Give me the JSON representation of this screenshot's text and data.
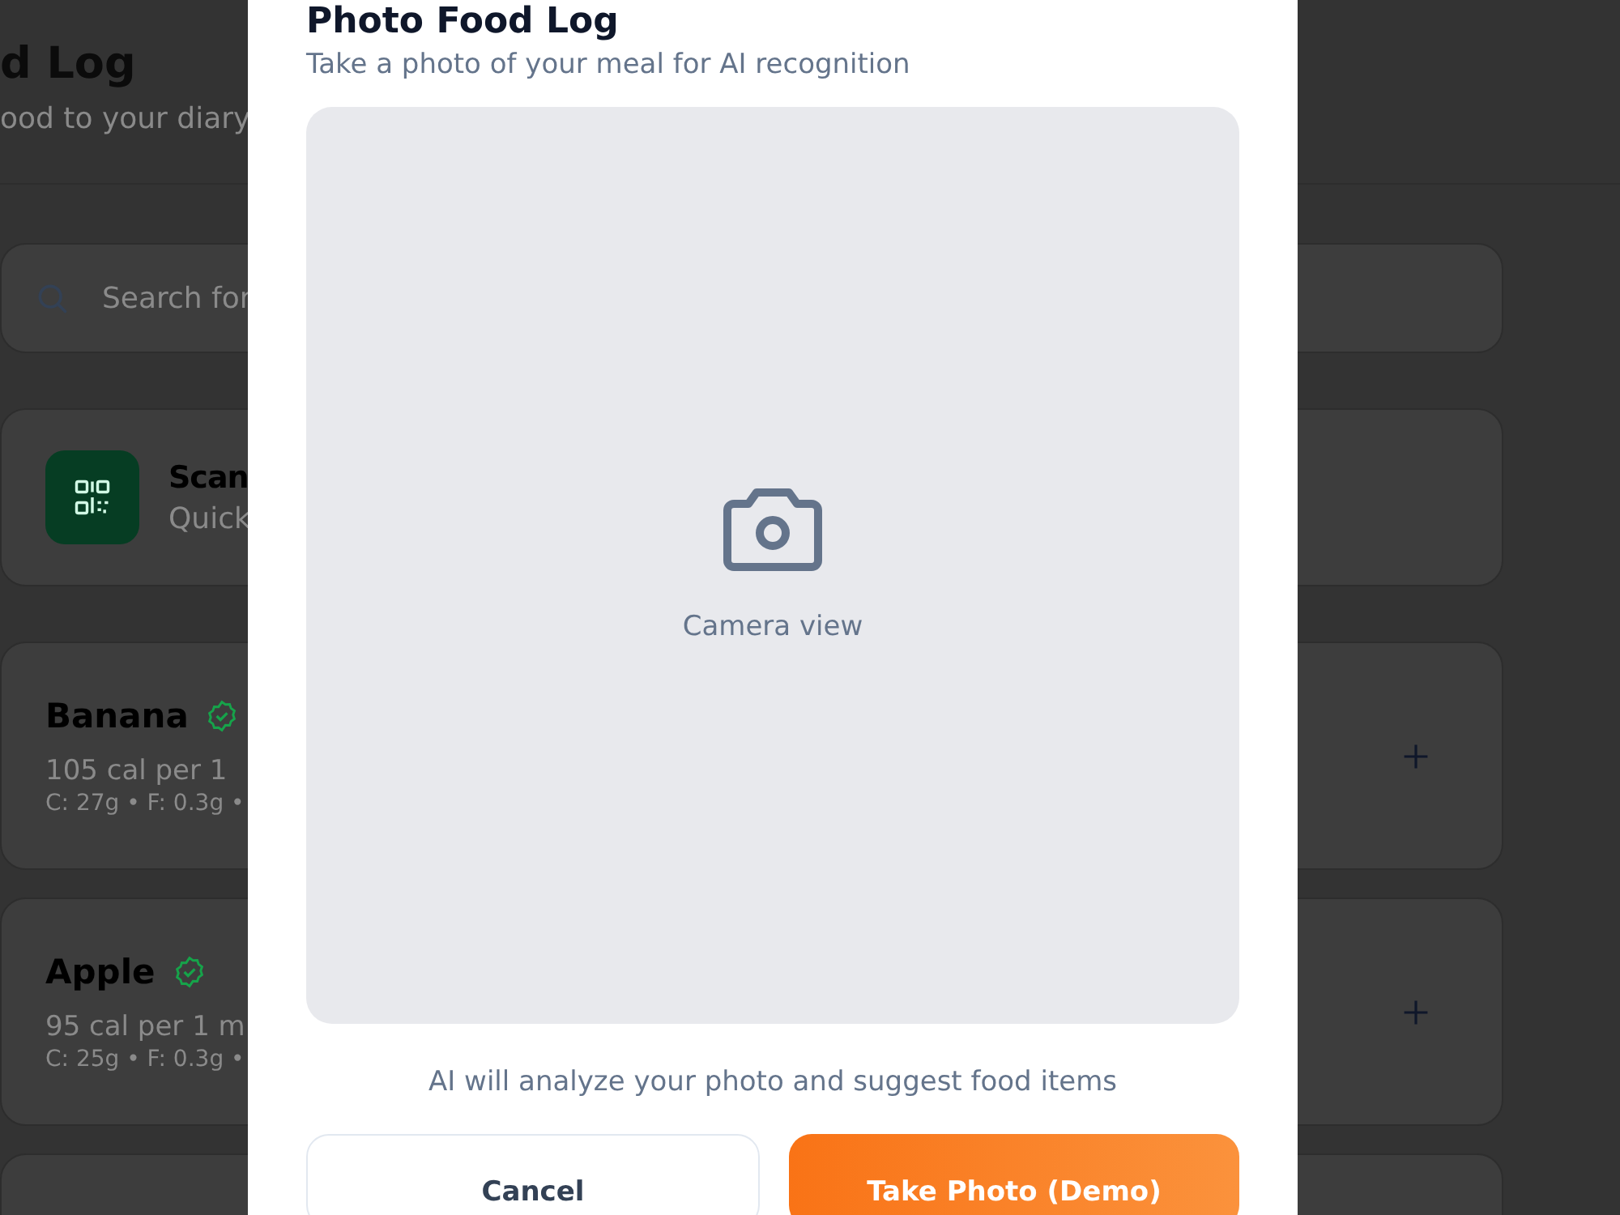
{
  "page": {
    "title": "d Log",
    "subtitle": "ood to your diary"
  },
  "search": {
    "placeholder": "Search for"
  },
  "scan_card": {
    "title": "Scan",
    "subtitle": "Quick"
  },
  "foods": [
    {
      "name": "Banana",
      "verified": true,
      "calories": "105 cal per 1",
      "macros": "C: 27g • F: 0.3g •"
    },
    {
      "name": "Apple",
      "verified": true,
      "calories": "95 cal per 1 m",
      "macros": "C: 25g • F: 0.3g •"
    }
  ],
  "modal": {
    "title": "Photo Food Log",
    "subtitle": "Take a photo of your meal for AI recognition",
    "camera_label": "Camera view",
    "hint": "AI will analyze your photo and suggest food items",
    "buttons": [
      {
        "label": "Cancel",
        "kind": "secondary"
      },
      {
        "label": "Take Photo (Demo)",
        "kind": "primary"
      }
    ]
  }
}
